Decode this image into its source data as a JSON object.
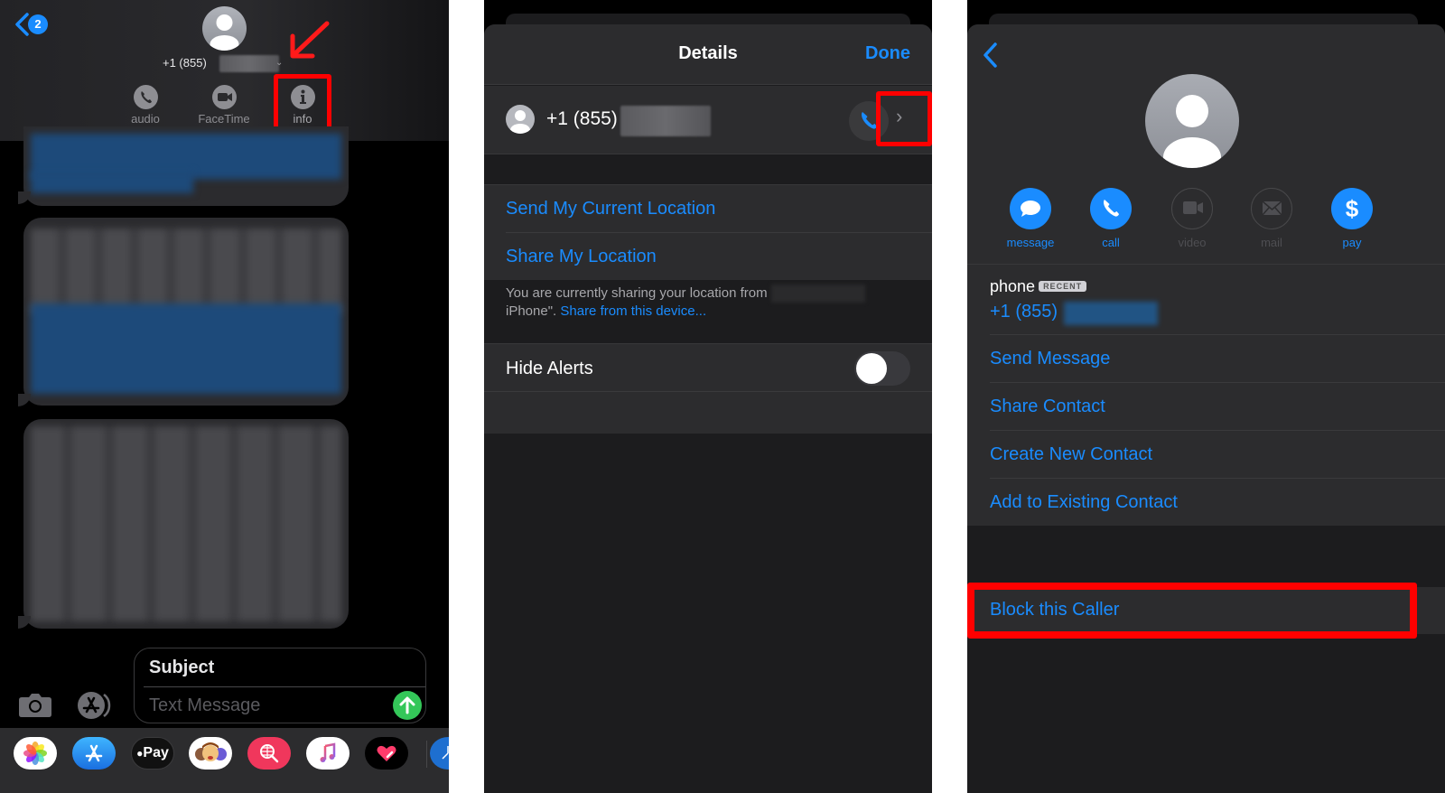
{
  "panel1": {
    "unread_badge": "2",
    "contact_phone": "+1 (855)",
    "actions": [
      {
        "label": "audio",
        "icon": "phone-icon"
      },
      {
        "label": "FaceTime",
        "icon": "video-camera-icon"
      },
      {
        "label": "info",
        "icon": "info-icon"
      }
    ],
    "composer": {
      "subject": "Subject",
      "placeholder": "Text Message"
    },
    "dock_apps": [
      {
        "name": "Photos",
        "icon": "photos-icon"
      },
      {
        "name": "App Store",
        "icon": "app-store-icon"
      },
      {
        "name": "Apple Pay",
        "label": "Pay",
        "icon": "apple-pay-icon"
      },
      {
        "name": "Memoji",
        "icon": "memoji-icon"
      },
      {
        "name": "Images",
        "icon": "globe-search-icon"
      },
      {
        "name": "Music",
        "icon": "music-icon"
      },
      {
        "name": "Digital Touch",
        "icon": "heart-icon"
      }
    ],
    "colors": {
      "accent": "#1a8cff",
      "send": "#34c759",
      "highlight": "#ff0000"
    }
  },
  "panel2": {
    "title": "Details",
    "done": "Done",
    "contact_phone": "+1 (855)",
    "location_items": [
      "Send My Current Location",
      "Share My Location"
    ],
    "footnote_prefix": "You are currently sharing your location from",
    "footnote_suffix": "iPhone\".",
    "footnote_link": "Share from this device...",
    "hide_alerts": {
      "label": "Hide Alerts",
      "on": false
    }
  },
  "panel3": {
    "actions": [
      {
        "label": "message",
        "enabled": true,
        "icon": "message-bubble-icon"
      },
      {
        "label": "call",
        "enabled": true,
        "icon": "phone-icon"
      },
      {
        "label": "video",
        "enabled": false,
        "icon": "video-camera-icon"
      },
      {
        "label": "mail",
        "enabled": false,
        "icon": "mail-icon"
      },
      {
        "label": "pay",
        "enabled": true,
        "icon": "dollar-icon"
      }
    ],
    "phone_label": "phone",
    "recent_badge": "RECENT",
    "phone_number": "+1 (855)",
    "menu_items": [
      "Send Message",
      "Share Contact",
      "Create New Contact",
      "Add to Existing Contact"
    ],
    "block": "Block this Caller"
  }
}
